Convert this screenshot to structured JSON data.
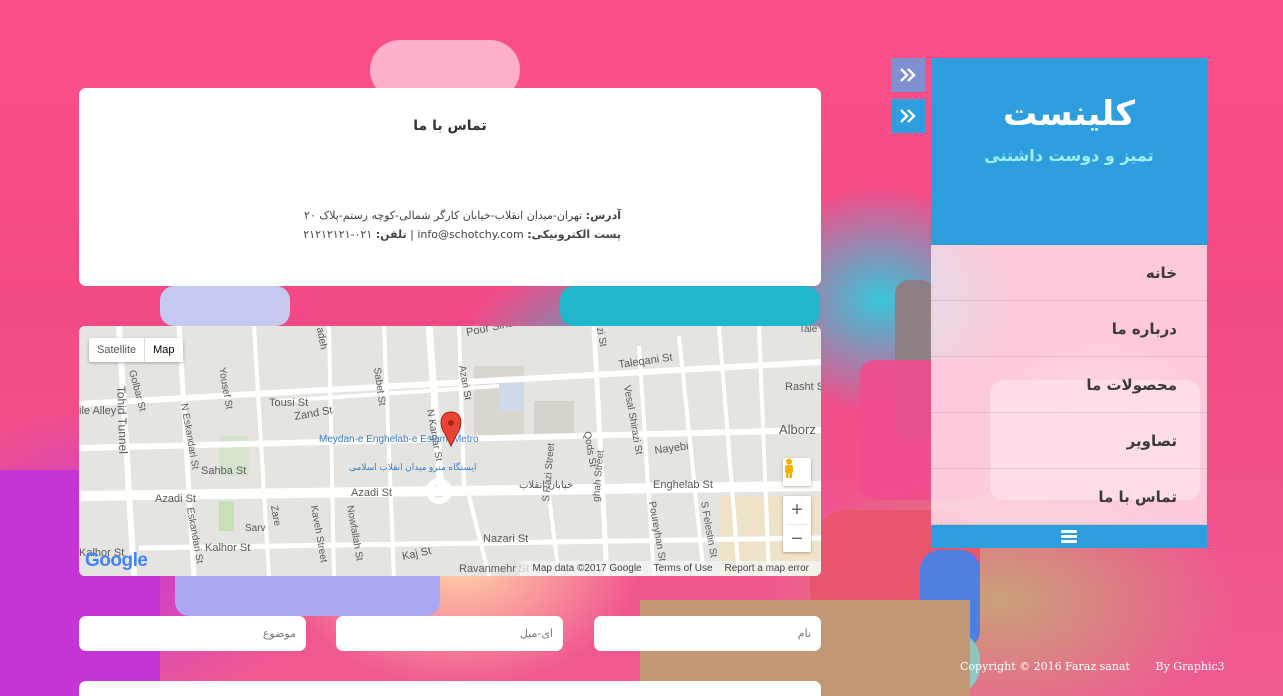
{
  "sidebar": {
    "brand": "کلینست",
    "tagline": "تمیز و دوست داشتنی",
    "items": [
      {
        "label": "خانه"
      },
      {
        "label": "درباره ما"
      },
      {
        "label": "محصولات ما"
      },
      {
        "label": "تصاویر"
      },
      {
        "label": "تماس با ما"
      }
    ],
    "toggle_icon": "double-chevron-right-icon",
    "menu_icon": "hamburger-icon"
  },
  "contact": {
    "title": "تماس با ما",
    "address_label": "آدرس:",
    "address_value": "تهران-میدان انقلاب-خیابان کارگر شمالی-کوچه رستم-پلاک ۲۰",
    "email_label": "پست الکترونیکی:",
    "email_value": "info@schotchy.com",
    "separator": "|",
    "phone_label": "تلفن:",
    "phone_value": "۰۲۱-۲۱۲۱۲۱۲۱"
  },
  "map": {
    "type_map": "Map",
    "type_satellite": "Satellite",
    "zoom_in": "+",
    "zoom_out": "−",
    "google": "Google",
    "footer_data": "Map data ©2017 Google",
    "footer_terms": "Terms of Use",
    "footer_report": "Report a map error",
    "streets": {
      "pour_sina": "Pour Sina",
      "azari": "Azari St",
      "taleqani": "Taleqani St",
      "rasht": "Rasht S",
      "golbarg": "Golbar St",
      "yousef": "Yousef St",
      "sabet": "Sabet St",
      "tousi": "Tousi St",
      "zand": "Zand St",
      "n_kargar": "N Kargar St",
      "qods": "Qods St",
      "vesal": "Vesal Shirazi St",
      "alborz": "Alborz",
      "n_eskandari": "N Eskandari St",
      "nayebi": "Nayebi",
      "tohid_tunnel": "Tohid Tunnel",
      "sahba": "Sahba St",
      "metro_en": "Meydan-e Enghelab-e Eslami Metro",
      "metro_fa": "ایستگاه مترو میدان انقلاب اسلامی",
      "azadi": "Azadi St",
      "azadi2": "Azadi St",
      "enghelab_fa": "خیابان انقلاب",
      "enghelab": "Enghelab St",
      "s_eskandari": "Eskandari St",
      "sarv": "Sarv",
      "zare": "Zare",
      "kaveh": "Kaveh Street",
      "nowfallah": "Nowfallah St",
      "s_razi": "S Razi Street",
      "ghah": "ghah Street",
      "pourehan": "Poureyhan St",
      "s_felestin": "S Felestin St",
      "kalhor": "Kalhor St",
      "kalhor2": "Kalhor St",
      "kaj": "Kaj St",
      "nazari": "Nazari St",
      "ravanmehr": "Ravanmehr St",
      "ilie": "ile Alley",
      "adeh": "adeh",
      "zi_st": "zi St",
      "tale": "Tale"
    }
  },
  "form": {
    "name_placeholder": "نام",
    "email_placeholder": "ای-میل",
    "subject_placeholder": "موضوع"
  },
  "footer": {
    "copyright": "Copyright © 2016 Faraz sanat",
    "by": "By Graphic3"
  },
  "colors": {
    "accent_blue": "#2e9ede",
    "tagline_cyan": "#9ff0f6",
    "background_pink": "#fb4f8a",
    "pin_red": "#ea4335"
  }
}
